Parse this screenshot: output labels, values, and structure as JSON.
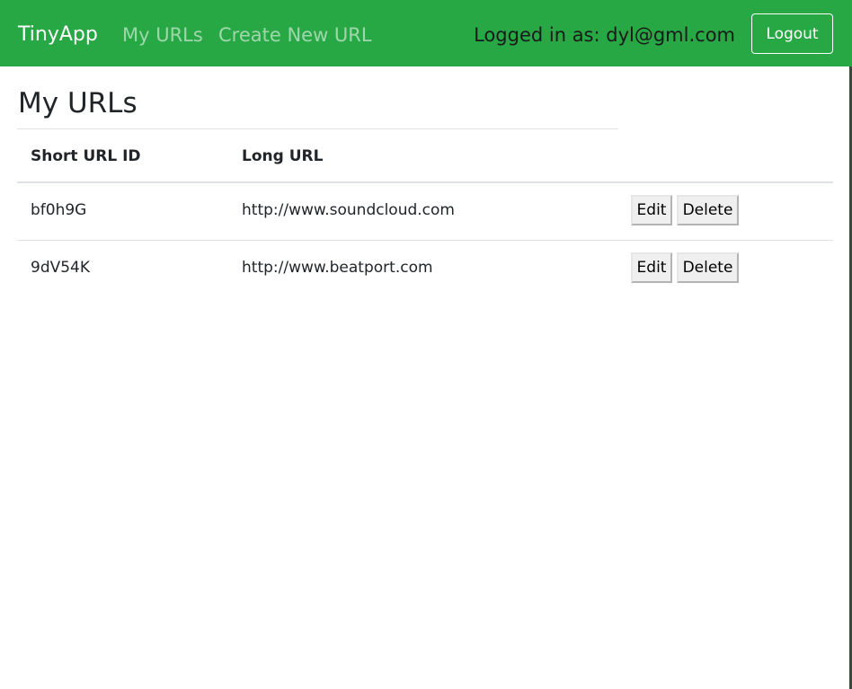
{
  "navbar": {
    "brand": "TinyApp",
    "links": [
      "My URLs",
      "Create New URL"
    ],
    "logged_in_text": "Logged in as: dyl@gml.com",
    "logout_label": "Logout",
    "bg_color": "#28a745"
  },
  "main": {
    "title": "My URLs",
    "table": {
      "headers": [
        "Short URL ID",
        "Long URL"
      ],
      "rows": [
        {
          "short_id": "bf0h9G",
          "long_url": "http://www.soundcloud.com",
          "edit_label": "Edit",
          "delete_label": "Delete"
        },
        {
          "short_id": "9dV54K",
          "long_url": "http://www.beatport.com",
          "edit_label": "Edit",
          "delete_label": "Delete"
        }
      ]
    }
  }
}
